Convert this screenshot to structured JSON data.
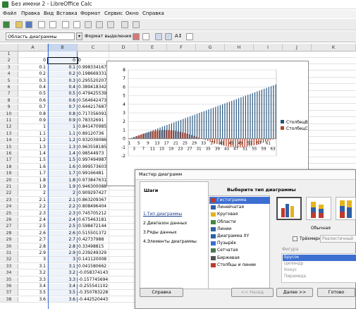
{
  "window": {
    "title": "Без имени 2 - LibreOffice Calc"
  },
  "menu": [
    "Файл",
    "Правка",
    "Вид",
    "Вставка",
    "Формат",
    "Сервис",
    "Окно",
    "Справка"
  ],
  "toolbar2": {
    "area": "Область диаграммы",
    "format_selection": "Формат выделения"
  },
  "columns": [
    "A",
    "B",
    "C",
    "D",
    "E",
    "F",
    "G",
    "H",
    "I",
    "J",
    "K"
  ],
  "rows": [
    {
      "n": "1",
      "a": "",
      "b": "",
      "c": ""
    },
    {
      "n": "2",
      "a": "0",
      "b": "0",
      "c": "0"
    },
    {
      "n": "3",
      "a": "0.1",
      "b": "0.1",
      "c": "0.998334167"
    },
    {
      "n": "4",
      "a": "0.2",
      "b": "0.2",
      "c": "0.198669331"
    },
    {
      "n": "5",
      "a": "0.3",
      "b": "0.3",
      "c": "0.295520207"
    },
    {
      "n": "6",
      "a": "0.4",
      "b": "0.4",
      "c": "0.389418342"
    },
    {
      "n": "7",
      "a": "0.5",
      "b": "0.5",
      "c": "0.479425539"
    },
    {
      "n": "8",
      "a": "0.6",
      "b": "0.6",
      "c": "0.564642473"
    },
    {
      "n": "9",
      "a": "0.7",
      "b": "0.7",
      "c": "0.644217687"
    },
    {
      "n": "10",
      "a": "0.8",
      "b": "0.8",
      "c": "0.717356091"
    },
    {
      "n": "11",
      "a": "0.9",
      "b": "0.9",
      "c": "0.78332691"
    },
    {
      "n": "12",
      "a": "1",
      "b": "1",
      "c": "0.841470985"
    },
    {
      "n": "13",
      "a": "1.1",
      "b": "1.1",
      "c": "0.89120736"
    },
    {
      "n": "14",
      "a": "1.2",
      "b": "1.2",
      "c": "0.932039086"
    },
    {
      "n": "15",
      "a": "1.3",
      "b": "1.3",
      "c": "0.963558185"
    },
    {
      "n": "16",
      "a": "1.4",
      "b": "1.4",
      "c": "0.98544973"
    },
    {
      "n": "17",
      "a": "1.5",
      "b": "1.5",
      "c": "0.997494987"
    },
    {
      "n": "18",
      "a": "1.6",
      "b": "1.6",
      "c": "0.999573603"
    },
    {
      "n": "19",
      "a": "1.7",
      "b": "1.7",
      "c": "0.99166481"
    },
    {
      "n": "20",
      "a": "1.8",
      "b": "1.8",
      "c": "0.973847631"
    },
    {
      "n": "21",
      "a": "1.9",
      "b": "1.9",
      "c": "0.946300088"
    },
    {
      "n": "22",
      "a": "2",
      "b": "2",
      "c": "0.909297427"
    },
    {
      "n": "23",
      "a": "2.1",
      "b": "2.1",
      "c": "0.863209367"
    },
    {
      "n": "24",
      "a": "2.2",
      "b": "2.2",
      "c": "0.808496404"
    },
    {
      "n": "25",
      "a": "2.3",
      "b": "2.3",
      "c": "0.745705212"
    },
    {
      "n": "26",
      "a": "2.4",
      "b": "2.4",
      "c": "0.675463181"
    },
    {
      "n": "27",
      "a": "2.5",
      "b": "2.5",
      "c": "0.598472144"
    },
    {
      "n": "28",
      "a": "2.6",
      "b": "2.6",
      "c": "0.515501372"
    },
    {
      "n": "29",
      "a": "2.7",
      "b": "2.7",
      "c": "0.42737988"
    },
    {
      "n": "30",
      "a": "2.8",
      "b": "2.8",
      "c": "0.33498815"
    },
    {
      "n": "31",
      "a": "2.9",
      "b": "2.9",
      "c": "0.239249329"
    },
    {
      "n": "32",
      "a": "3",
      "b": "3",
      "c": "0.141120008"
    },
    {
      "n": "33",
      "a": "3.1",
      "b": "3.1",
      "c": "0.041580662"
    },
    {
      "n": "34",
      "a": "3.2",
      "b": "3.2",
      "c": "-0.058374143"
    },
    {
      "n": "35",
      "a": "3.3",
      "b": "3.3",
      "c": "-0.157745694"
    },
    {
      "n": "36",
      "a": "3.4",
      "b": "3.4",
      "c": "-0.255541102"
    },
    {
      "n": "37",
      "a": "3.5",
      "b": "3.5",
      "c": "-0.350783228"
    },
    {
      "n": "38",
      "a": "3.6",
      "b": "3.6",
      "c": "-0.442520443"
    }
  ],
  "chart": {
    "y_ticks": [
      "8",
      "7",
      "6",
      "5",
      "4",
      "3",
      "2",
      "1",
      "0",
      "-1",
      "-2"
    ],
    "x_ticks": [
      "1",
      "3",
      "5",
      "7",
      "9",
      "11",
      "13",
      "15",
      "17",
      "19",
      "21",
      "23",
      "25",
      "27",
      "29",
      "31",
      "33",
      "35",
      "37",
      "39",
      "41",
      "43",
      "45",
      "47",
      "49",
      "51",
      "53",
      "55",
      "57",
      "59",
      "61",
      "63"
    ],
    "legend": [
      "СтолбецB",
      "СтолбецC"
    ],
    "colors": {
      "b": "#1f4e79",
      "c": "#b4442a"
    }
  },
  "dialog": {
    "title": "Мастер диаграмм",
    "steps_header": "Шаги",
    "steps": [
      "1.Тип диаграммы",
      "2.Диапазон данных",
      "3.Ряды данных",
      "4.Элементы диаграммы"
    ],
    "types_header": "Выберите тип диаграммы",
    "types": [
      "Гистограмма",
      "Линейчатая",
      "Круговая",
      "Области",
      "Линии",
      "Диаграмма XY",
      "Пузырёк",
      "Сетчатая",
      "Биржевая",
      "Столбцы и линии"
    ],
    "variant_label": "Обычная",
    "threed_label": "Трёхмерный вид",
    "threed_select": "Реалистичный",
    "shape_label": "Фигура",
    "shapes": [
      "Брусок",
      "Цилиндр",
      "Конус",
      "Пирамида"
    ],
    "buttons": {
      "help": "Справка",
      "back": "<< Назад",
      "next": "Далее >>",
      "finish": "Готово"
    }
  }
}
